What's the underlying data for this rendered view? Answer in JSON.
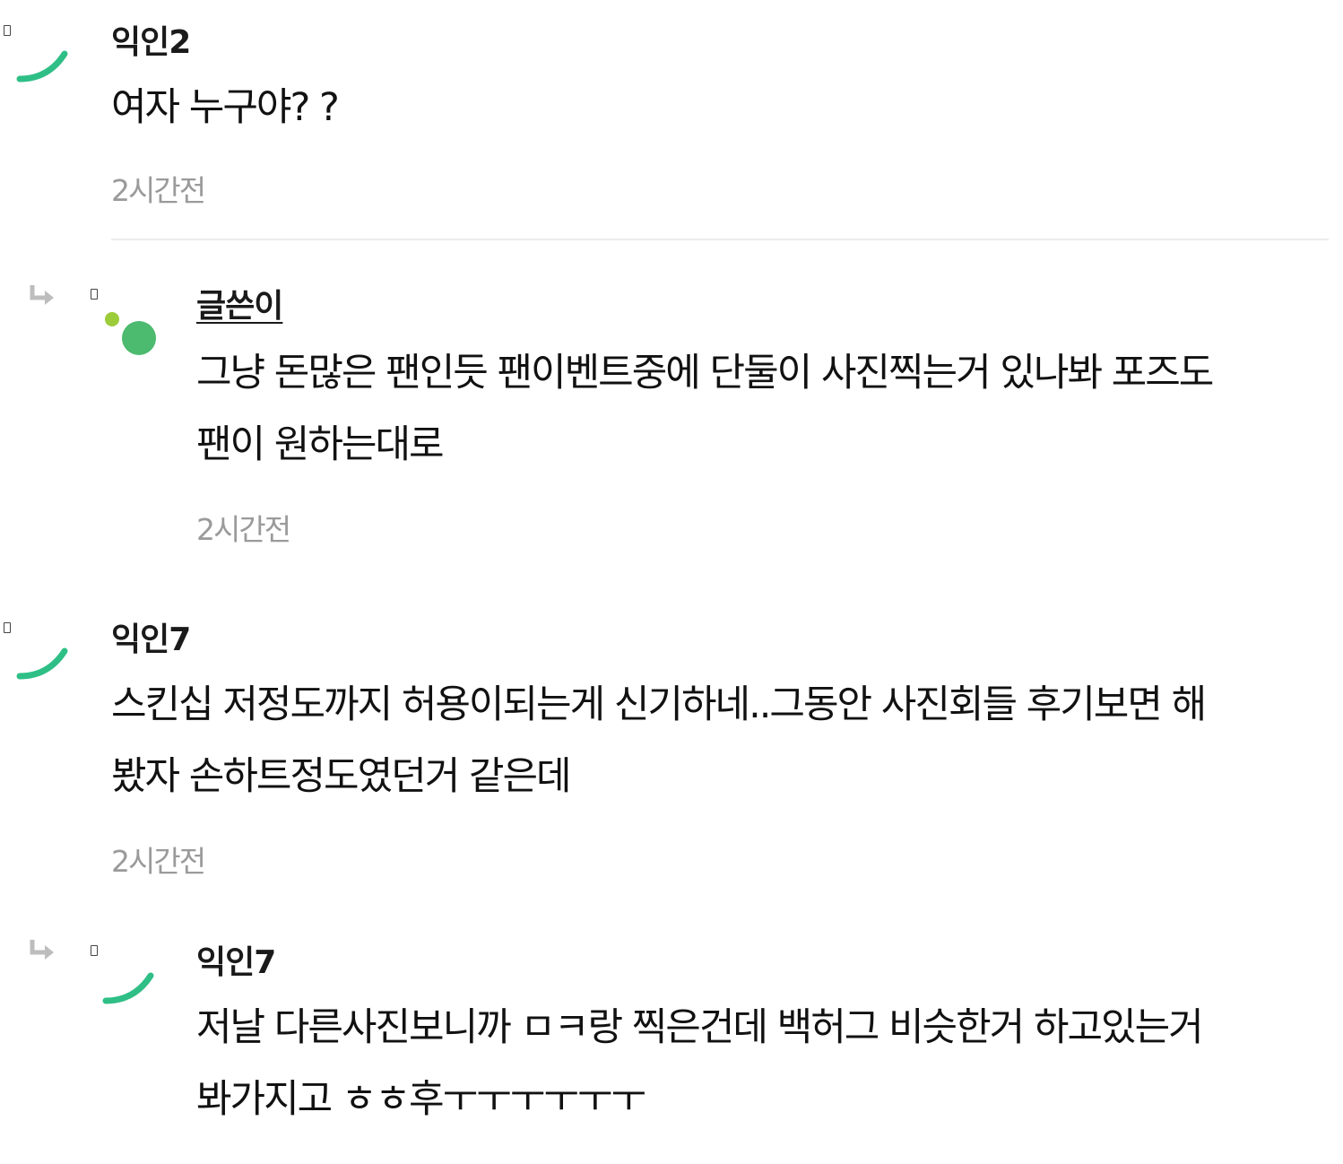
{
  "comments": [
    {
      "author": "익인2",
      "lines": [
        "여자 누구야? ?"
      ],
      "time": "2시간전",
      "avatar": "green-arc-icon"
    },
    {
      "author": "글쓴이",
      "is_reply": true,
      "is_op": true,
      "lines": [
        "그냥 돈많은 팬인듯 팬이벤트중에 단둘이 사진찍는거 있나봐 포즈도",
        "팬이 원하는대로"
      ],
      "time": "2시간전",
      "avatar": "green-dots-icon"
    },
    {
      "author": "익인7",
      "lines": [
        "스킨십 저정도까지 허용이되는게 신기하네..그동안 사진회들 후기보면 해",
        "봤자 손하트정도였던거 같은데"
      ],
      "time": "2시간전",
      "avatar": "green-arc-icon"
    },
    {
      "author": "익인7",
      "is_reply": true,
      "lines": [
        "저날 다른사진보니까 ㅁㅋ랑 찍은건데 백허그 비슷한거 하고있는거",
        "봐가지고 ㅎㅎ후ㅜㅜㅜㅜㅜㅜ"
      ],
      "avatar": "green-arc-icon"
    }
  ],
  "colors": {
    "accent_green": "#2fbf86",
    "op_green": "#4cba6f",
    "op_dot": "#9ccc3a",
    "timestamp": "#9a9a9a"
  }
}
